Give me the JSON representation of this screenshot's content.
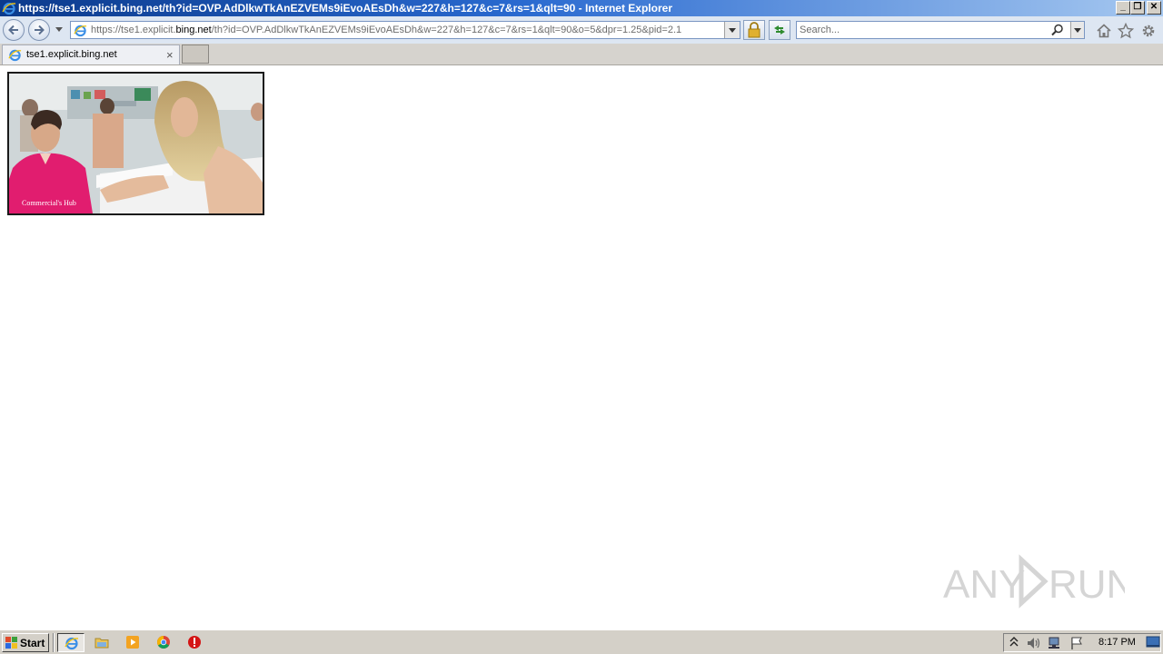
{
  "window": {
    "title": "https://tse1.explicit.bing.net/th?id=OVP.AdDlkwTkAnEZVEMs9iEvoAEsDh&w=227&h=127&c=7&rs=1&qlt=90 - Internet Explorer",
    "minimize_glyph": "_",
    "restore_glyph": "❐",
    "close_glyph": "✕"
  },
  "address_bar": {
    "url_prefix": "https://tse1.explicit.",
    "url_domain": "bing.net",
    "url_rest": "/th?id=OVP.AdDlkwTkAnEZVEMs9iEvoAEsDh&w=227&h=127&c=7&rs=1&qlt=90&o=5&dpr=1.25&pid=2.1"
  },
  "search": {
    "placeholder": "Search..."
  },
  "tabs": [
    {
      "label": "tse1.explicit.bing.net",
      "close_glyph": "×",
      "icon": "ie-icon"
    }
  ],
  "content": {
    "image_caption": "Commercial's Hub"
  },
  "watermark": {
    "text_left": "ANY",
    "text_right": "RUN"
  },
  "taskbar": {
    "start_label": "Start",
    "clock": "8:17 PM",
    "apps": [
      "ie-icon",
      "folder-icon",
      "media-player-icon",
      "chrome-icon",
      "security-app-icon"
    ]
  },
  "colors": {
    "title_bar": "#0b3a8c",
    "taskbar": "#d4d0c8",
    "tab_bar": "#d6d3ce",
    "nav_bar": "#dde6f2"
  }
}
